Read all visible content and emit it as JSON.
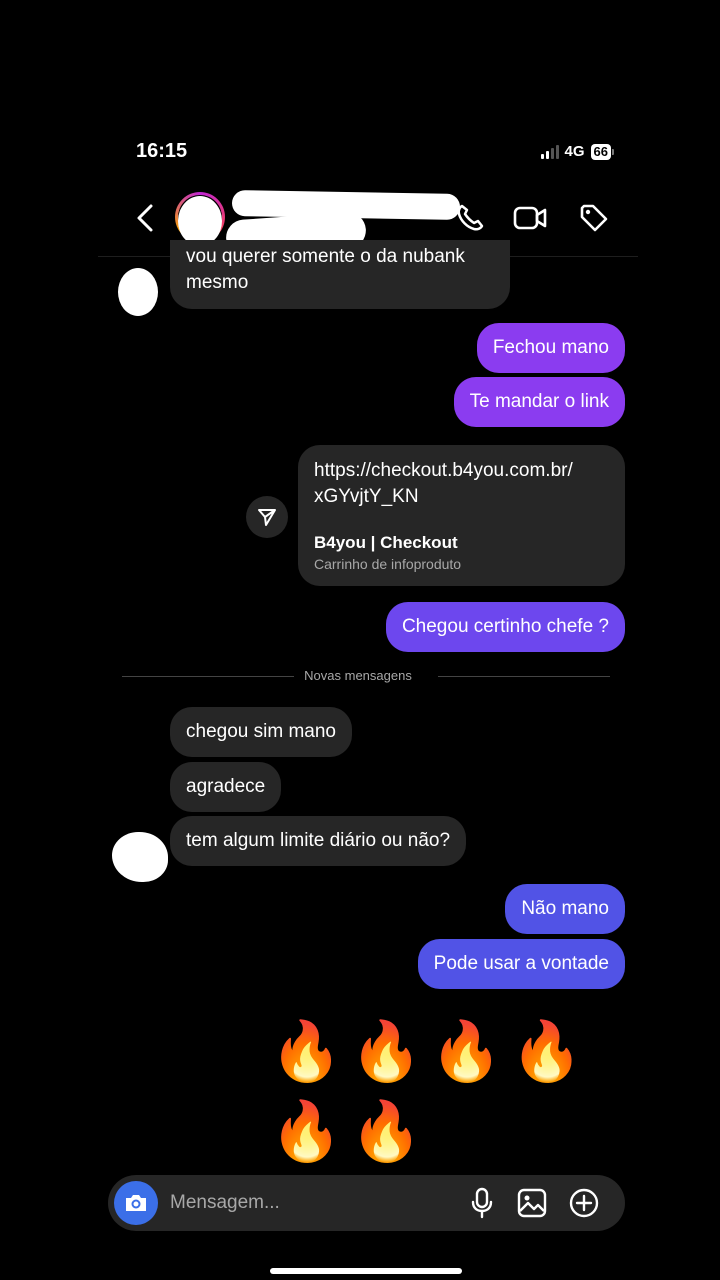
{
  "status_bar": {
    "time": "16:15",
    "network": "4G",
    "battery": "66"
  },
  "messages": {
    "incoming_top": "vou querer somente o da nubank\nmesmo",
    "out_1": "Fechou mano",
    "out_2": "Te mandar o link",
    "link": {
      "url": "https://checkout.b4you.com.br/\nxGYvjtY_KN",
      "title": "B4you | Checkout",
      "subtitle": "Carrinho de infoproduto"
    },
    "out_3": "Chegou certinho chefe ?",
    "new_messages": "Novas mensagens",
    "in_1": "chegou sim mano",
    "in_2": "agradece",
    "in_3": "tem algum limite diário ou não?",
    "out_4": "Não mano",
    "out_5": "Pode usar a vontade",
    "emojis": "🔥🔥🔥🔥🔥🔥"
  },
  "composer": {
    "placeholder": "Mensagem..."
  },
  "colors": {
    "out_top": "#8b3cf0",
    "out_mid": "#6d47ee",
    "out_bottom": "#5153e6",
    "incoming": "#262626",
    "camera": "#3b6fe8"
  }
}
